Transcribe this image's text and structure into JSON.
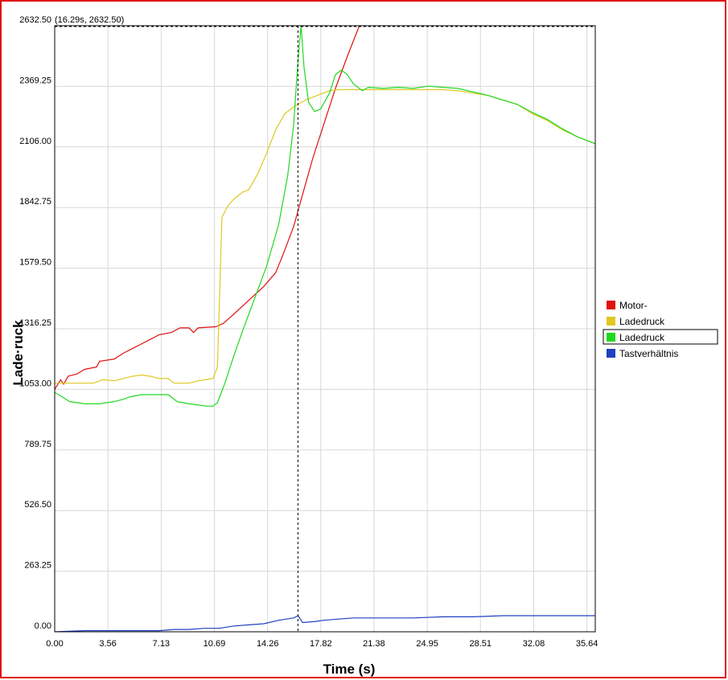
{
  "chart_data": {
    "type": "line",
    "xlabel": "Time (s)",
    "ylabel": "Ladedruck",
    "ylabel_visible": "Lade·ruck",
    "xlim": [
      0,
      36.2
    ],
    "ylim": [
      0,
      2632.5
    ],
    "x_ticks": [
      "0.00",
      "3.56",
      "7.13",
      "10.69",
      "14.26",
      "17.82",
      "21.38",
      "24.95",
      "28.51",
      "32.08",
      "35.64"
    ],
    "x_tick_values": [
      0,
      3.56,
      7.13,
      10.69,
      14.26,
      17.82,
      21.38,
      24.95,
      28.51,
      32.08,
      35.64
    ],
    "y_ticks": [
      "0.00",
      "263.25",
      "526.50",
      "789.75",
      "1053.00",
      "1316.25",
      "1579.50",
      "1842.75",
      "2106.00",
      "2369.25",
      "2632.50"
    ],
    "y_tick_values": [
      0,
      263.25,
      526.5,
      789.75,
      1053,
      1316.25,
      1579.5,
      1842.75,
      2106,
      2369.25,
      2632.5
    ],
    "grid": true,
    "legend_position": "right",
    "cursor": {
      "x": 16.29,
      "y": 2632.5,
      "label": "(16.29s, 2632.50)"
    },
    "series": [
      {
        "name": "Motor-",
        "color": "#e01010",
        "points": [
          [
            0.0,
            1053
          ],
          [
            0.4,
            1095
          ],
          [
            0.6,
            1075
          ],
          [
            0.9,
            1110
          ],
          [
            1.5,
            1120
          ],
          [
            2.0,
            1140
          ],
          [
            2.8,
            1150
          ],
          [
            3.0,
            1175
          ],
          [
            4.0,
            1185
          ],
          [
            4.6,
            1210
          ],
          [
            5.2,
            1230
          ],
          [
            5.8,
            1250
          ],
          [
            6.4,
            1270
          ],
          [
            7.0,
            1290
          ],
          [
            7.8,
            1300
          ],
          [
            8.4,
            1320
          ],
          [
            9.0,
            1320
          ],
          [
            9.3,
            1300
          ],
          [
            9.6,
            1320
          ],
          [
            10.8,
            1325
          ],
          [
            11.3,
            1340
          ],
          [
            12.0,
            1380
          ],
          [
            13.0,
            1440
          ],
          [
            14.0,
            1500
          ],
          [
            14.8,
            1560
          ],
          [
            15.3,
            1640
          ],
          [
            16.0,
            1760
          ],
          [
            16.6,
            1900
          ],
          [
            17.3,
            2060
          ],
          [
            18.0,
            2200
          ],
          [
            18.8,
            2360
          ],
          [
            19.6,
            2500
          ],
          [
            20.4,
            2632.5
          ]
        ]
      },
      {
        "name": "Ladedruck",
        "color": "#e0c820",
        "points": [
          [
            0.0,
            1080
          ],
          [
            1.5,
            1080
          ],
          [
            2.6,
            1080
          ],
          [
            3.2,
            1095
          ],
          [
            4.0,
            1090
          ],
          [
            4.6,
            1100
          ],
          [
            5.2,
            1110
          ],
          [
            5.8,
            1115
          ],
          [
            6.4,
            1110
          ],
          [
            7.0,
            1100
          ],
          [
            7.6,
            1100
          ],
          [
            8.0,
            1080
          ],
          [
            9.0,
            1080
          ],
          [
            9.6,
            1090
          ],
          [
            10.6,
            1100
          ],
          [
            10.9,
            1150
          ],
          [
            11.2,
            1800
          ],
          [
            11.6,
            1850
          ],
          [
            12.0,
            1880
          ],
          [
            12.6,
            1910
          ],
          [
            13.0,
            1920
          ],
          [
            13.6,
            1990
          ],
          [
            14.2,
            2080
          ],
          [
            14.8,
            2180
          ],
          [
            15.4,
            2250
          ],
          [
            16.0,
            2280
          ],
          [
            16.8,
            2310
          ],
          [
            17.6,
            2330
          ],
          [
            18.4,
            2350
          ],
          [
            19.0,
            2355
          ],
          [
            20.0,
            2355
          ],
          [
            22.0,
            2355
          ],
          [
            24.0,
            2355
          ],
          [
            26.0,
            2355
          ],
          [
            27.0,
            2350
          ],
          [
            28.0,
            2340
          ],
          [
            29.0,
            2330
          ],
          [
            30.0,
            2310
          ],
          [
            31.0,
            2290
          ],
          [
            32.0,
            2250
          ],
          [
            33.0,
            2220
          ],
          [
            34.0,
            2180
          ],
          [
            35.0,
            2150
          ],
          [
            36.2,
            2120
          ]
        ]
      },
      {
        "name": "Ladedruck",
        "color": "#20d820",
        "points": [
          [
            0.0,
            1040
          ],
          [
            0.5,
            1020
          ],
          [
            1.0,
            1000
          ],
          [
            2.0,
            990
          ],
          [
            3.0,
            990
          ],
          [
            4.0,
            1000
          ],
          [
            4.6,
            1010
          ],
          [
            5.0,
            1020
          ],
          [
            5.8,
            1030
          ],
          [
            6.6,
            1030
          ],
          [
            7.6,
            1030
          ],
          [
            8.2,
            1000
          ],
          [
            9.0,
            990
          ],
          [
            9.6,
            985
          ],
          [
            10.2,
            980
          ],
          [
            10.6,
            980
          ],
          [
            10.9,
            995
          ],
          [
            11.4,
            1080
          ],
          [
            12.0,
            1200
          ],
          [
            12.6,
            1310
          ],
          [
            13.4,
            1450
          ],
          [
            14.2,
            1590
          ],
          [
            15.0,
            1770
          ],
          [
            15.6,
            1980
          ],
          [
            16.0,
            2200
          ],
          [
            16.29,
            2480
          ],
          [
            16.5,
            2632.5
          ],
          [
            16.7,
            2450
          ],
          [
            17.0,
            2300
          ],
          [
            17.4,
            2260
          ],
          [
            17.8,
            2270
          ],
          [
            18.4,
            2340
          ],
          [
            18.8,
            2420
          ],
          [
            19.2,
            2440
          ],
          [
            19.6,
            2420
          ],
          [
            20.0,
            2380
          ],
          [
            20.6,
            2350
          ],
          [
            21.0,
            2365
          ],
          [
            22.0,
            2360
          ],
          [
            23.0,
            2365
          ],
          [
            24.0,
            2360
          ],
          [
            25.0,
            2370
          ],
          [
            26.0,
            2365
          ],
          [
            27.0,
            2360
          ],
          [
            28.0,
            2345
          ],
          [
            29.0,
            2330
          ],
          [
            30.0,
            2310
          ],
          [
            31.0,
            2290
          ],
          [
            32.0,
            2255
          ],
          [
            33.0,
            2225
          ],
          [
            34.0,
            2185
          ],
          [
            35.0,
            2150
          ],
          [
            36.2,
            2120
          ]
        ]
      },
      {
        "name": "Tastverhältnis",
        "color": "#2040c0",
        "points": [
          [
            0.0,
            0
          ],
          [
            2.0,
            5
          ],
          [
            5.0,
            5
          ],
          [
            7.0,
            5
          ],
          [
            8.0,
            10
          ],
          [
            9.0,
            10
          ],
          [
            10.0,
            15
          ],
          [
            11.0,
            15
          ],
          [
            12.0,
            25
          ],
          [
            13.0,
            30
          ],
          [
            14.0,
            35
          ],
          [
            15.0,
            50
          ],
          [
            16.0,
            60
          ],
          [
            16.3,
            70
          ],
          [
            16.6,
            40
          ],
          [
            17.5,
            45
          ],
          [
            18.0,
            50
          ],
          [
            19.0,
            55
          ],
          [
            20.0,
            60
          ],
          [
            22.0,
            60
          ],
          [
            24.0,
            60
          ],
          [
            26.0,
            65
          ],
          [
            28.0,
            65
          ],
          [
            30.0,
            70
          ],
          [
            32.0,
            70
          ],
          [
            34.0,
            70
          ],
          [
            36.2,
            70
          ]
        ]
      }
    ]
  },
  "legend": {
    "items": [
      "Motor-",
      "Ladedruck",
      "Ladedruck",
      "Tastverhältnis"
    ],
    "colors": [
      "#e01010",
      "#e0c820",
      "#20d820",
      "#2040c0"
    ],
    "selected_index": 2
  },
  "colors": {
    "frame": "#e01010",
    "grid": "#d8d8d8",
    "cursor": "#000000"
  }
}
